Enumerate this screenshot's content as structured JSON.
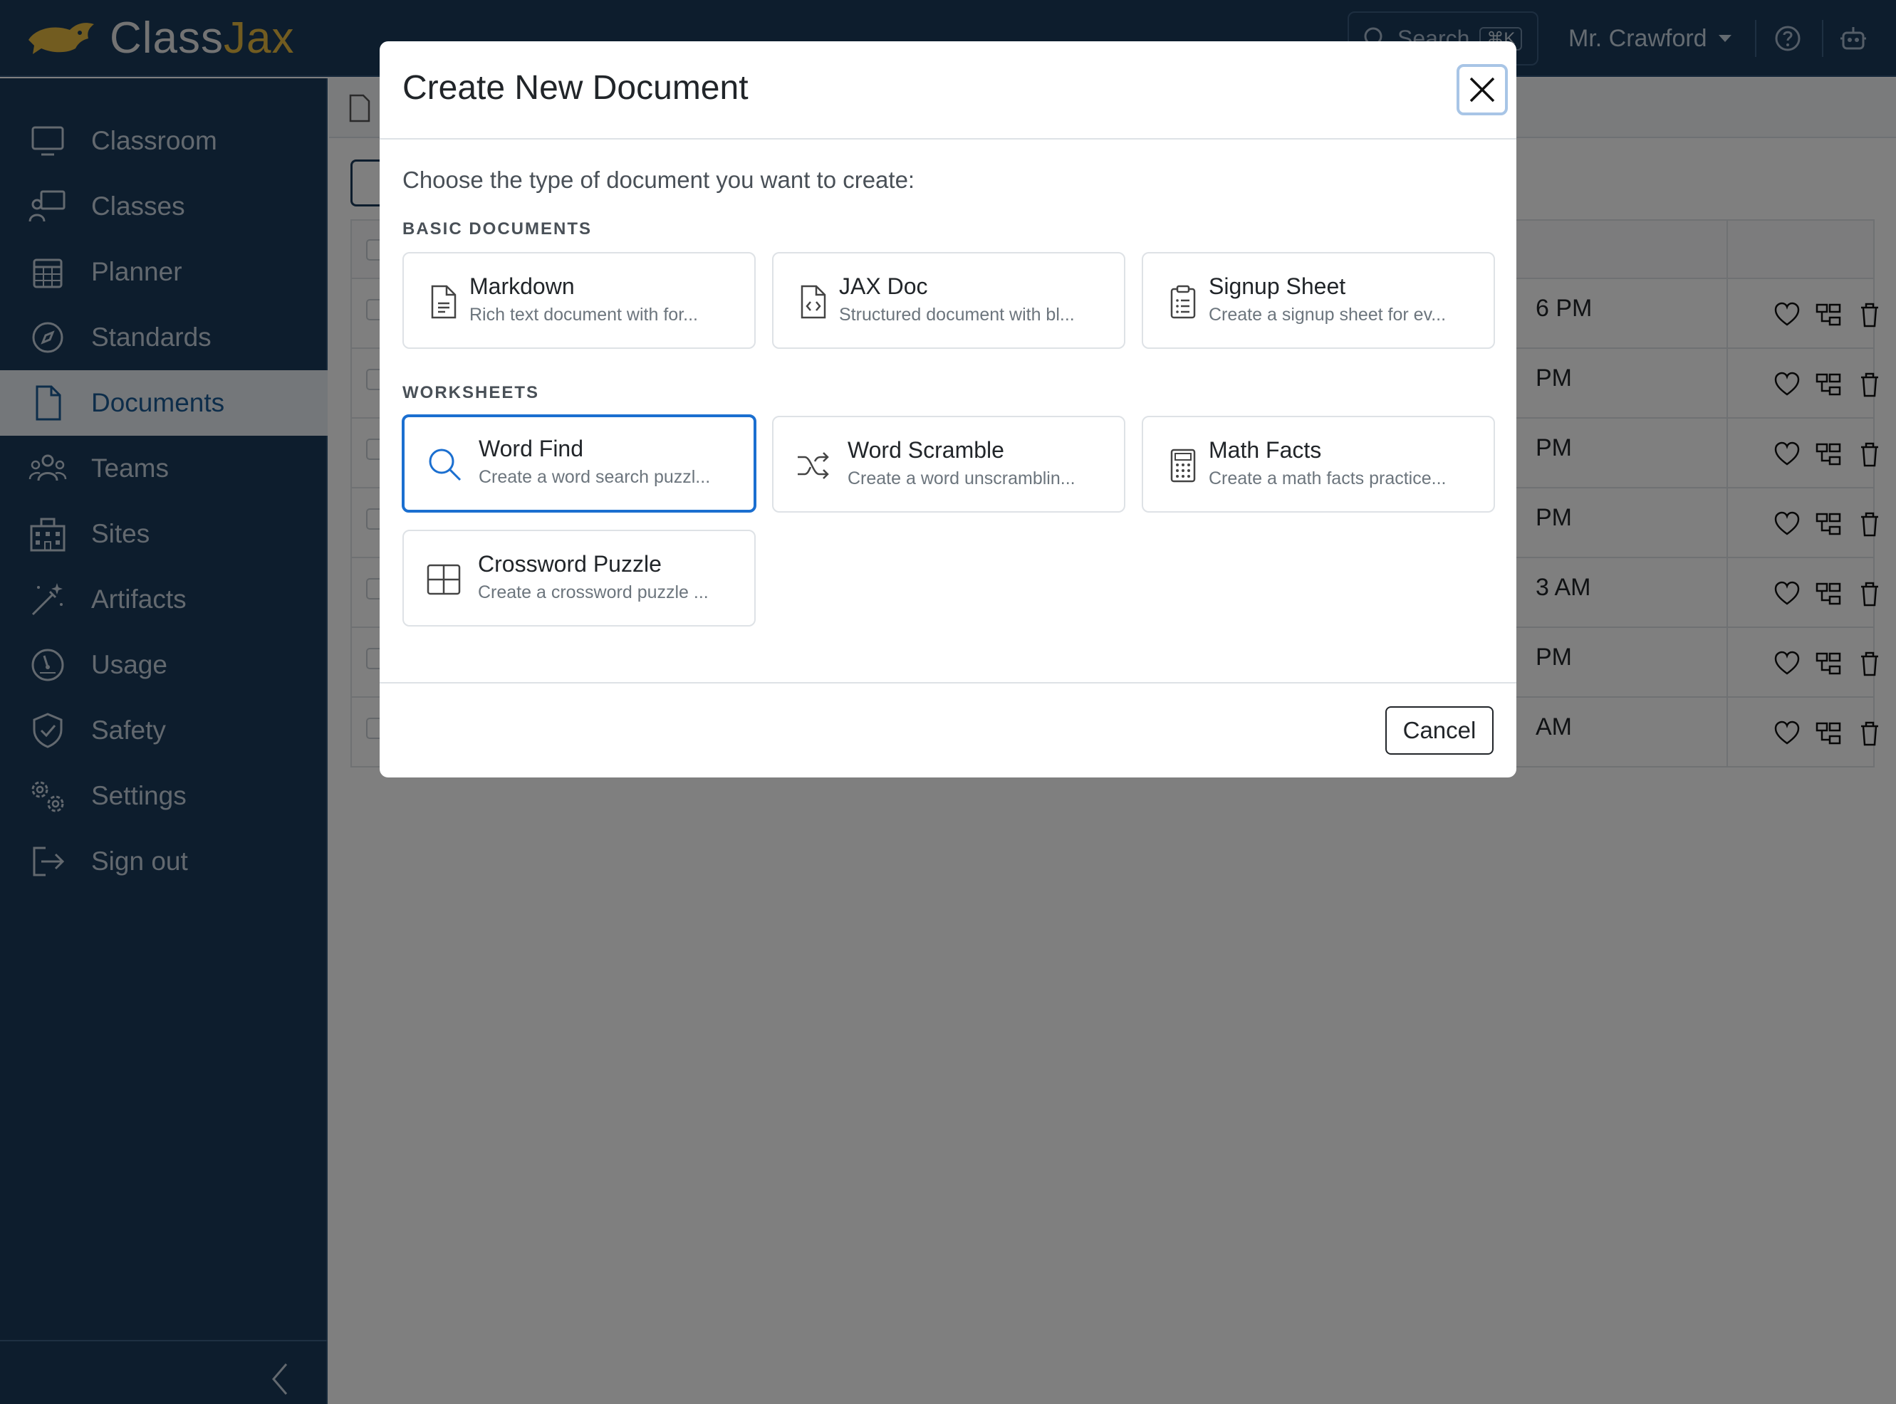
{
  "app": {
    "brand_part1": "Class",
    "brand_part2": "Jax",
    "search_placeholder": "Search",
    "search_shortcut": "⌘K",
    "user_name": "Mr. Crawford"
  },
  "sidebar": {
    "items": [
      {
        "label": "Classroom",
        "icon": "monitor-icon"
      },
      {
        "label": "Classes",
        "icon": "teacher-board-icon"
      },
      {
        "label": "Planner",
        "icon": "calendar-icon"
      },
      {
        "label": "Standards",
        "icon": "compass-icon"
      },
      {
        "label": "Documents",
        "icon": "document-icon",
        "active": true
      },
      {
        "label": "Teams",
        "icon": "people-icon"
      },
      {
        "label": "Sites",
        "icon": "building-icon"
      },
      {
        "label": "Artifacts",
        "icon": "magic-wand-icon"
      },
      {
        "label": "Usage",
        "icon": "speedometer-icon"
      },
      {
        "label": "Safety",
        "icon": "shield-check-icon"
      },
      {
        "label": "Settings",
        "icon": "gears-icon"
      },
      {
        "label": "Sign out",
        "icon": "sign-out-icon"
      }
    ]
  },
  "table": {
    "rows": [
      {
        "date_fragment": "6 PM"
      },
      {
        "date_fragment": "PM"
      },
      {
        "date_fragment": "PM"
      },
      {
        "date_fragment": "PM"
      },
      {
        "date_fragment": "3 AM"
      },
      {
        "date_fragment": "PM"
      },
      {
        "date_fragment": "AM"
      }
    ]
  },
  "modal": {
    "title": "Create New Document",
    "intro": "Choose the type of document you want to create:",
    "sections": [
      {
        "label": "BASIC DOCUMENTS",
        "cards": [
          {
            "title": "Markdown",
            "description": "Rich text document with for...",
            "icon": "file-text-icon"
          },
          {
            "title": "JAX Doc",
            "description": "Structured document with bl...",
            "icon": "file-code-icon"
          },
          {
            "title": "Signup Sheet",
            "description": "Create a signup sheet for ev...",
            "icon": "clipboard-list-icon"
          }
        ]
      },
      {
        "label": "WORKSHEETS",
        "cards": [
          {
            "title": "Word Find",
            "description": "Create a word search puzzl...",
            "icon": "search-icon",
            "selected": true
          },
          {
            "title": "Word Scramble",
            "description": "Create a word unscramblin...",
            "icon": "shuffle-icon"
          },
          {
            "title": "Math Facts",
            "description": "Create a math facts practice...",
            "icon": "calculator-icon"
          },
          {
            "title": "Crossword Puzzle",
            "description": "Create a crossword puzzle ...",
            "icon": "grid-icon"
          }
        ]
      }
    ],
    "cancel_label": "Cancel"
  },
  "colors": {
    "sidebar_bg": "#1b3a5b",
    "brand_accent": "#e5b840",
    "selected_border": "#1b6fd0",
    "active_nav_text": "#1b5a94"
  }
}
